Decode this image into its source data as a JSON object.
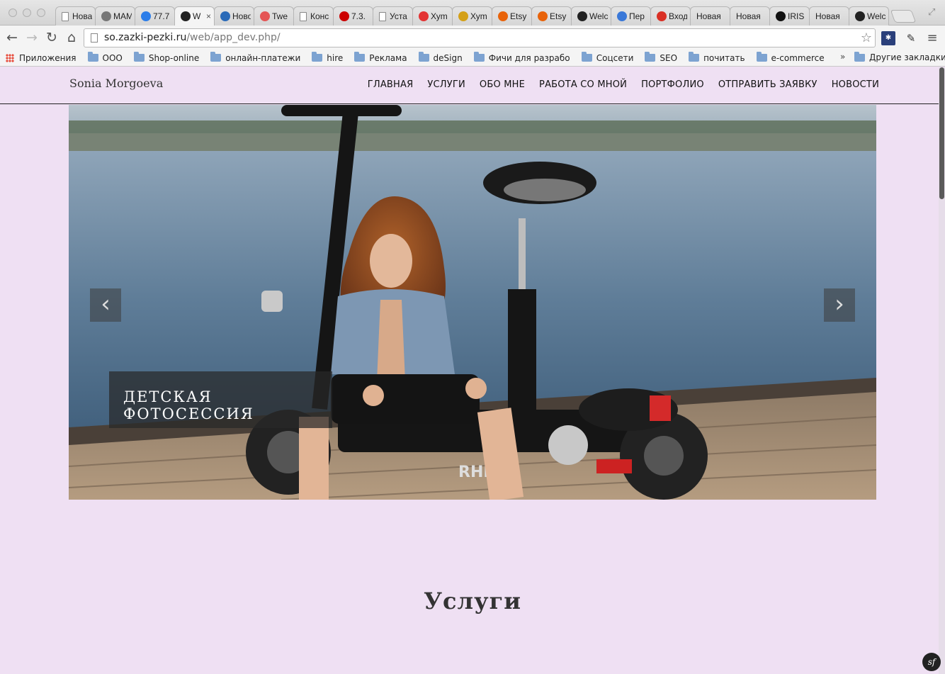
{
  "browser": {
    "tabs": [
      {
        "label": "Новая",
        "icon": "page-icon",
        "color": "#ffffff"
      },
      {
        "label": "МАМ",
        "icon": "gear-icon",
        "color": "#777777"
      },
      {
        "label": "77.7",
        "icon": "check-circle-icon",
        "color": "#2b7de9"
      },
      {
        "label": "W",
        "icon": "symfony-icon",
        "color": "#222222",
        "active": true
      },
      {
        "label": "Ново",
        "icon": "newspaper-icon",
        "color": "#2a6ab8"
      },
      {
        "label": "Twe",
        "icon": "circle-icon",
        "color": "#e45555"
      },
      {
        "label": "Конс",
        "icon": "page-icon",
        "color": "#ffffff"
      },
      {
        "label": "7.3.",
        "icon": "redhat-icon",
        "color": "#cc0000"
      },
      {
        "label": "Уста",
        "icon": "page-icon",
        "color": "#ffffff"
      },
      {
        "label": "Хуm",
        "icon": "yandex-icon",
        "color": "#e33333"
      },
      {
        "label": "Хуm",
        "icon": "chart-icon",
        "color": "#d4a017"
      },
      {
        "label": "Etsy",
        "icon": "etsy-icon",
        "color": "#e8630a"
      },
      {
        "label": "Etsy",
        "icon": "etsy-icon",
        "color": "#e8630a"
      },
      {
        "label": "Welc",
        "icon": "symfony-icon",
        "color": "#222222"
      },
      {
        "label": "Пер",
        "icon": "translate-icon",
        "color": "#3a78d8"
      },
      {
        "label": "Вход",
        "icon": "gmail-icon",
        "color": "#d93025"
      },
      {
        "label": "Новая",
        "icon": "none",
        "color": "#ffffff"
      },
      {
        "label": "Новая",
        "icon": "none",
        "color": "#ffffff"
      },
      {
        "label": "IRIS",
        "icon": "info-icon",
        "color": "#111111"
      },
      {
        "label": "Новая",
        "icon": "none",
        "color": "#ffffff"
      },
      {
        "label": "Welc",
        "icon": "symfony-icon",
        "color": "#222222"
      }
    ],
    "url_host": "so.zazki-pezki.ru",
    "url_path": "/web/app_dev.php/",
    "bookmarks": [
      "Приложения",
      "ООО",
      "Shop-online",
      "онлайн-платежи",
      "hire",
      "Реклама",
      "deSign",
      "Фичи для разработч",
      "Соцсети",
      "SEO",
      "почитать",
      "e-commerce"
    ],
    "bookmarks_overflow": "»",
    "other_bookmarks": "Другие закладки"
  },
  "site": {
    "brand": "Sonia Morgoeva",
    "nav": [
      "ГЛАВНАЯ",
      "УСЛУГИ",
      "ОБО МНЕ",
      "РАБОТА СО МНОЙ",
      "ПОРТФОЛИО",
      "ОТПРАВИТЬ ЗАЯВКУ",
      "НОВОСТИ"
    ],
    "slider": {
      "caption": "ДЕТСКАЯ ФОТОСЕССИЯ",
      "prev": "‹",
      "next": "›",
      "scooter_brand": "RHINO"
    },
    "section_title": "Услуги",
    "badge": "sf"
  },
  "colors": {
    "page_bg": "#efe0f3",
    "header_border": "#222222",
    "caption_bg": "#282828"
  }
}
